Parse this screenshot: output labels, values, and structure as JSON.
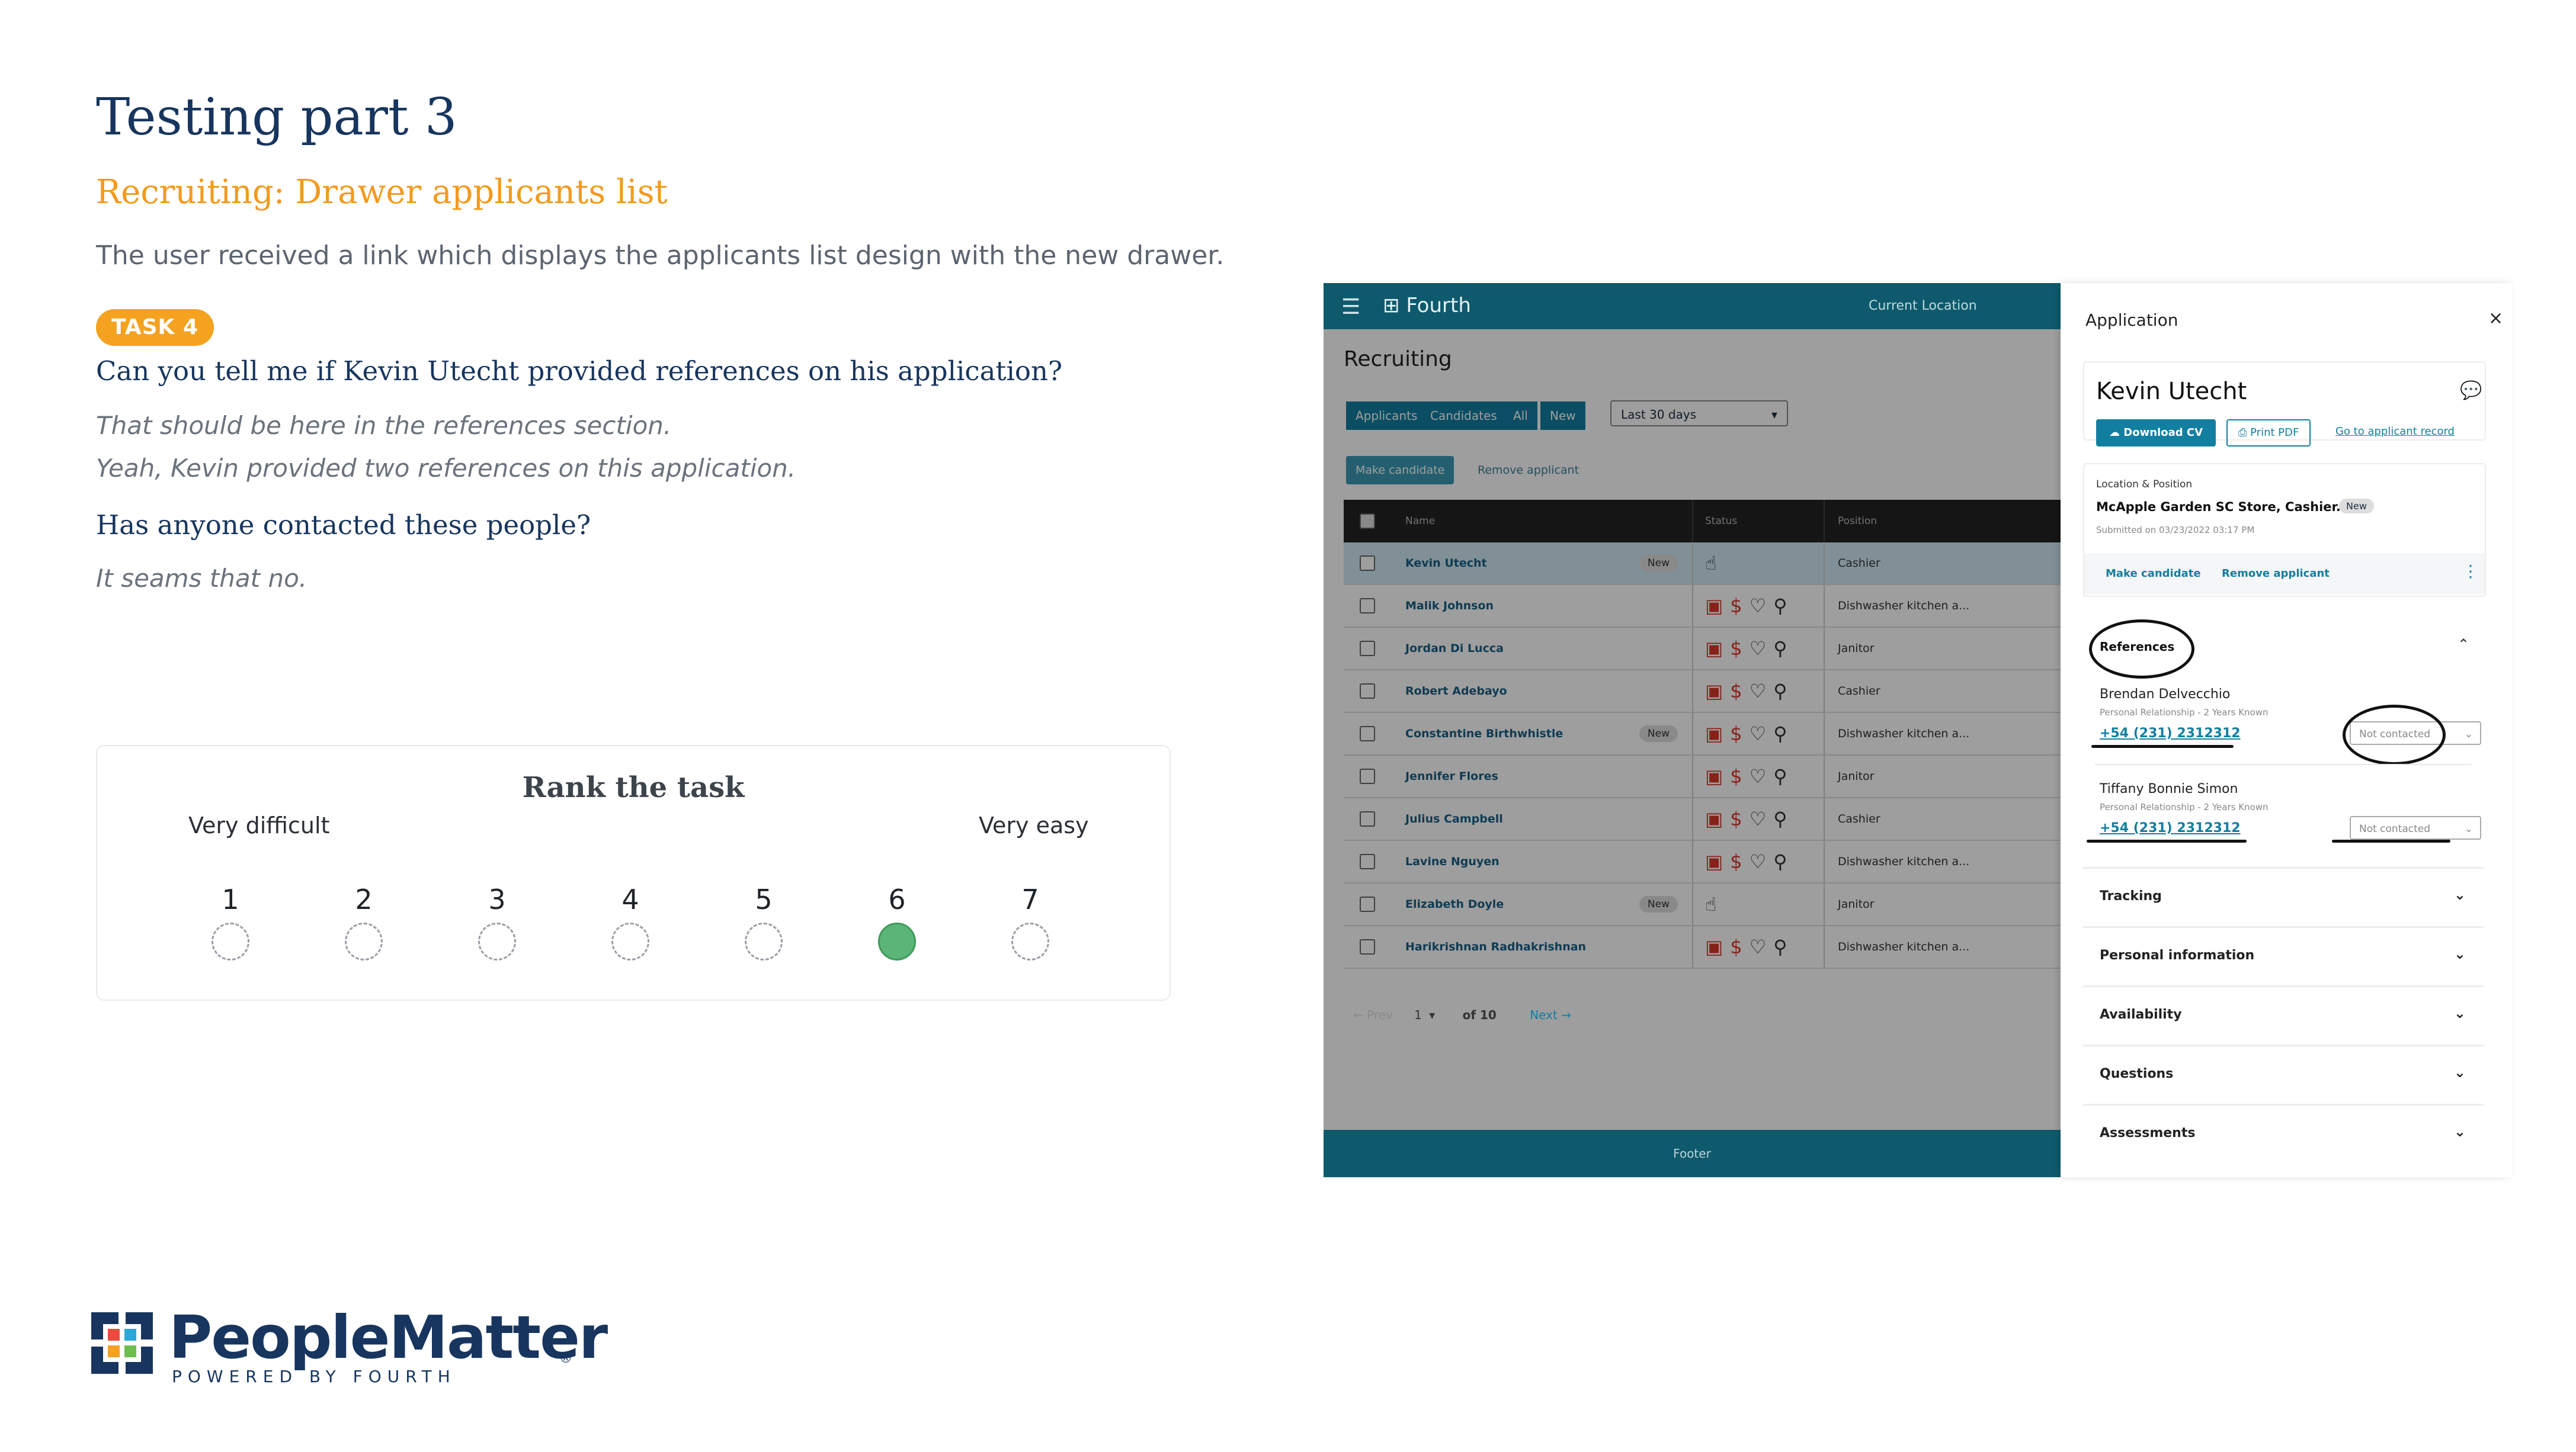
{
  "slide": {
    "title": "Testing part 3",
    "subtitle": "Recruiting: Drawer applicants list",
    "intro": "The user received a link which displays the applicants list design with the new drawer.",
    "task_label": "TASK 4",
    "q1": "Can you tell me if Kevin Utecht provided references on his application?",
    "a1_line1": "That should be here in the references section.",
    "a1_line2": "Yeah, Kevin provided  two references on this application.",
    "q2": "Has anyone contacted these people?",
    "a2": "It seams that no."
  },
  "rank": {
    "title": "Rank the task",
    "low_label": "Very difficult",
    "high_label": "Very easy",
    "options": [
      "1",
      "2",
      "3",
      "4",
      "5",
      "6",
      "7"
    ],
    "selected": "6"
  },
  "logo": {
    "name": "PeopleMatter",
    "tagline": "POWERED BY FOURTH",
    "reg": "®"
  },
  "app": {
    "brand": "Fourth",
    "current_location": "Current Location",
    "heading": "Recruiting",
    "filter_tabs": [
      "Applicants",
      "Candidates",
      "All",
      "New"
    ],
    "date_filter": "Last 30 days",
    "make_candidate": "Make candidate",
    "remove_applicant": "Remove applicant",
    "columns": {
      "name": "Name",
      "status": "Status",
      "position": "Position"
    },
    "rows": [
      {
        "name": "Kevin Utecht",
        "badge": "New",
        "position": "Cashier",
        "icons": "pointer"
      },
      {
        "name": "Malik Johnson",
        "badge": "",
        "position": "Dishwasher kitchen a...",
        "icons": "full"
      },
      {
        "name": "Jordan Di Lucca",
        "badge": "",
        "position": "Janitor",
        "icons": "full"
      },
      {
        "name": "Robert Adebayo",
        "badge": "",
        "position": "Cashier",
        "icons": "full"
      },
      {
        "name": "Constantine Birthwhistle",
        "badge": "New",
        "position": "Dishwasher kitchen a...",
        "icons": "full"
      },
      {
        "name": "Jennifer Flores",
        "badge": "",
        "position": "Janitor",
        "icons": "full"
      },
      {
        "name": "Julius Campbell",
        "badge": "",
        "position": "Cashier",
        "icons": "full"
      },
      {
        "name": "Lavine Nguyen",
        "badge": "",
        "position": "Dishwasher kitchen a...",
        "icons": "full"
      },
      {
        "name": "Elizabeth Doyle",
        "badge": "New",
        "position": "Janitor",
        "icons": "pointer"
      },
      {
        "name": "Harikrishnan Radhakrishnan",
        "badge": "",
        "position": "Dishwasher kitchen a...",
        "icons": "full"
      }
    ],
    "pager": {
      "prev": "← Prev",
      "page": "1",
      "of": "of 10",
      "next": "Next →"
    },
    "footer": "Footer"
  },
  "drawer": {
    "header": "Application",
    "close": "×",
    "applicant_name": "Kevin Utecht",
    "download_cv": "Download CV",
    "print_pdf": "Print PDF",
    "goto_record": "Go to applicant record",
    "location_label": "Location & Position",
    "location_value": "McApple Garden SC Store, Cashier.",
    "location_badge": "New",
    "submitted": "Submitted on 03/23/2022 03:17 PM",
    "make_candidate": "Make candidate",
    "remove_applicant": "Remove applicant",
    "references_title": "References",
    "references": [
      {
        "name": "Brendan Delvecchio",
        "relation": "Personal Relationship - 2 Years Known",
        "phone": "+54 (231) 2312312",
        "status": "Not contacted"
      },
      {
        "name": "Tiffany Bonnie Simon",
        "relation": "Personal Relationship - 2 Years Known",
        "phone": "+54 (231) 2312312",
        "status": "Not contacted"
      }
    ],
    "sections": [
      "Tracking",
      "Personal information",
      "Availability",
      "Questions",
      "Assessments"
    ]
  },
  "colors": {
    "brand_teal": "#0e5a6c",
    "accent_blue": "#127fa0",
    "orange": "#f39a1e",
    "navy": "#17355e",
    "selected_green": "#5cb578"
  }
}
